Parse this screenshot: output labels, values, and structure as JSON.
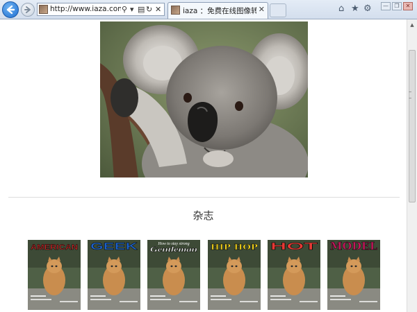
{
  "browser": {
    "address": {
      "url": "http://www.iaza.com/xp",
      "search_glyph": "⚲",
      "dropdown_glyph": "▾",
      "compat_glyph": "▤",
      "refresh_glyph": "↻",
      "stop_glyph": "✕"
    },
    "tab": {
      "title": "iaza ：免费在线图像转换-...",
      "close_glyph": "✕"
    },
    "tools": {
      "home_glyph": "⌂",
      "favorites_glyph": "★",
      "settings_glyph": "⚙"
    },
    "window": {
      "minimize_glyph": "—",
      "restore_glyph": "❐",
      "close_glyph": "✕"
    },
    "accent": "#1f6fd1"
  },
  "page": {
    "section_title": "杂志",
    "magazines": [
      {
        "title": "AMERICAN",
        "color": "#c62828",
        "style": "pixel"
      },
      {
        "title": "GEEK",
        "color": "#1e62c8",
        "style": "bold"
      },
      {
        "title": "Gentleman",
        "subtitle": "How to stay strong",
        "color": "#ffffff",
        "style": "script"
      },
      {
        "title": "HIP HOP",
        "color": "#f2d21e",
        "style": "serif"
      },
      {
        "title": "HOT",
        "color": "#e53935",
        "style": "bold"
      },
      {
        "title": "MODEL",
        "color": "#c2185b",
        "style": "serif"
      }
    ]
  },
  "scrollbar": {
    "up_glyph": "▲",
    "position_fraction": 0.0
  }
}
